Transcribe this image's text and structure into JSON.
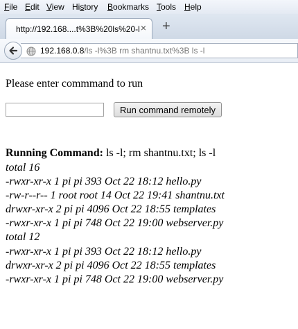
{
  "menubar": {
    "items": [
      {
        "key": "F",
        "rest": "ile"
      },
      {
        "key": "E",
        "rest": "dit"
      },
      {
        "key": "V",
        "rest": "iew"
      },
      {
        "key": "",
        "pre": "Hi",
        "key2": "s",
        "rest": "tory"
      },
      {
        "key": "B",
        "rest": "ookmarks"
      },
      {
        "key": "T",
        "rest": "ools"
      },
      {
        "key": "H",
        "rest": "elp"
      }
    ]
  },
  "tab": {
    "title": "http://192.168....t%3B%20ls%20-l",
    "close": "×",
    "new_tab": "+"
  },
  "urlbar": {
    "host": "192.168.0.8",
    "path": "/ls -l%3B rm shantnu.txt%3B ls -l"
  },
  "page": {
    "prompt": "Please enter commmand to run",
    "input_value": "",
    "button_label": "Run command remotely",
    "running_label": "Running Command:",
    "running_command": " ls -l; rm shantnu.txt; ls -l",
    "output_lines": [
      "total 16",
      "-rwxr-xr-x 1 pi pi 393 Oct 22 18:12 hello.py",
      "-rw-r--r-- 1 root root 14 Oct 22 19:41 shantnu.txt",
      "drwxr-xr-x 2 pi pi 4096 Oct 22 18:55 templates",
      "-rwxr-xr-x 1 pi pi 748 Oct 22 19:00 webserver.py",
      "total 12",
      "-rwxr-xr-x 1 pi pi 393 Oct 22 18:12 hello.py",
      "drwxr-xr-x 2 pi pi 4096 Oct 22 18:55 templates",
      "-rwxr-xr-x 1 pi pi 748 Oct 22 19:00 webserver.py"
    ]
  }
}
